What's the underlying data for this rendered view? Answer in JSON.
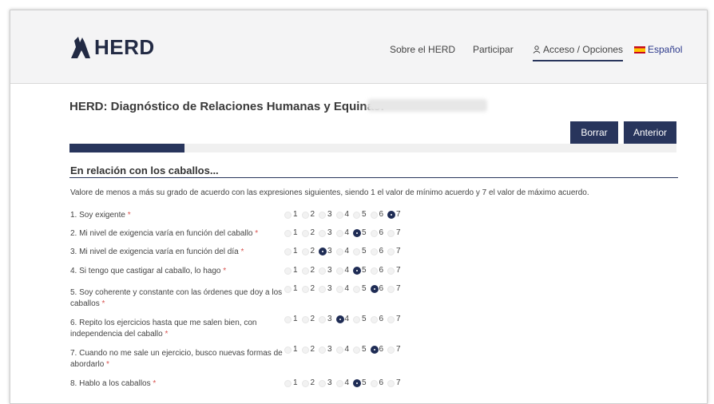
{
  "header": {
    "logo_text": "HERD",
    "nav": {
      "about": "Sobre el HERD",
      "participate": "Participar",
      "access": "Acceso / Opciones",
      "language": "Español"
    }
  },
  "page_title": "HERD: Diagnóstico de Relaciones Humanas y Equinas:",
  "buttons": {
    "clear": "Borrar",
    "previous": "Anterior"
  },
  "progress": 0.19,
  "section": {
    "title": "En relación con los caballos...",
    "instructions": "Valore de menos a más su grado de acuerdo con las expresiones siguientes, siendo 1 el valor de mínimo acuerdo y 7 el valor de máximo acuerdo."
  },
  "scale_options": [
    "1",
    "2",
    "3",
    "4",
    "5",
    "6",
    "7"
  ],
  "required_mark": "*",
  "questions": [
    {
      "text": "1. Soy exigente",
      "selected": 7
    },
    {
      "text": "2. Mi nivel de exigencia varía en función del caballo",
      "selected": 5
    },
    {
      "text": "3. Mi nivel de exigencia varía en función del día",
      "selected": 3
    },
    {
      "text": "4. Si tengo que castigar al caballo, lo hago",
      "selected": 5
    },
    {
      "text": "5. Soy coherente y constante con las órdenes que doy a los caballos",
      "selected": 6
    },
    {
      "text": "6. Repito los ejercicios hasta que me salen bien, con independencia del caballo",
      "selected": 4
    },
    {
      "text": "7. Cuando no me sale un ejercicio, busco nuevas formas de abordarlo",
      "selected": 6
    },
    {
      "text": "8. Hablo a los caballos",
      "selected": 5
    }
  ],
  "colors": {
    "brand": "#28355c",
    "required": "#d9534f"
  }
}
